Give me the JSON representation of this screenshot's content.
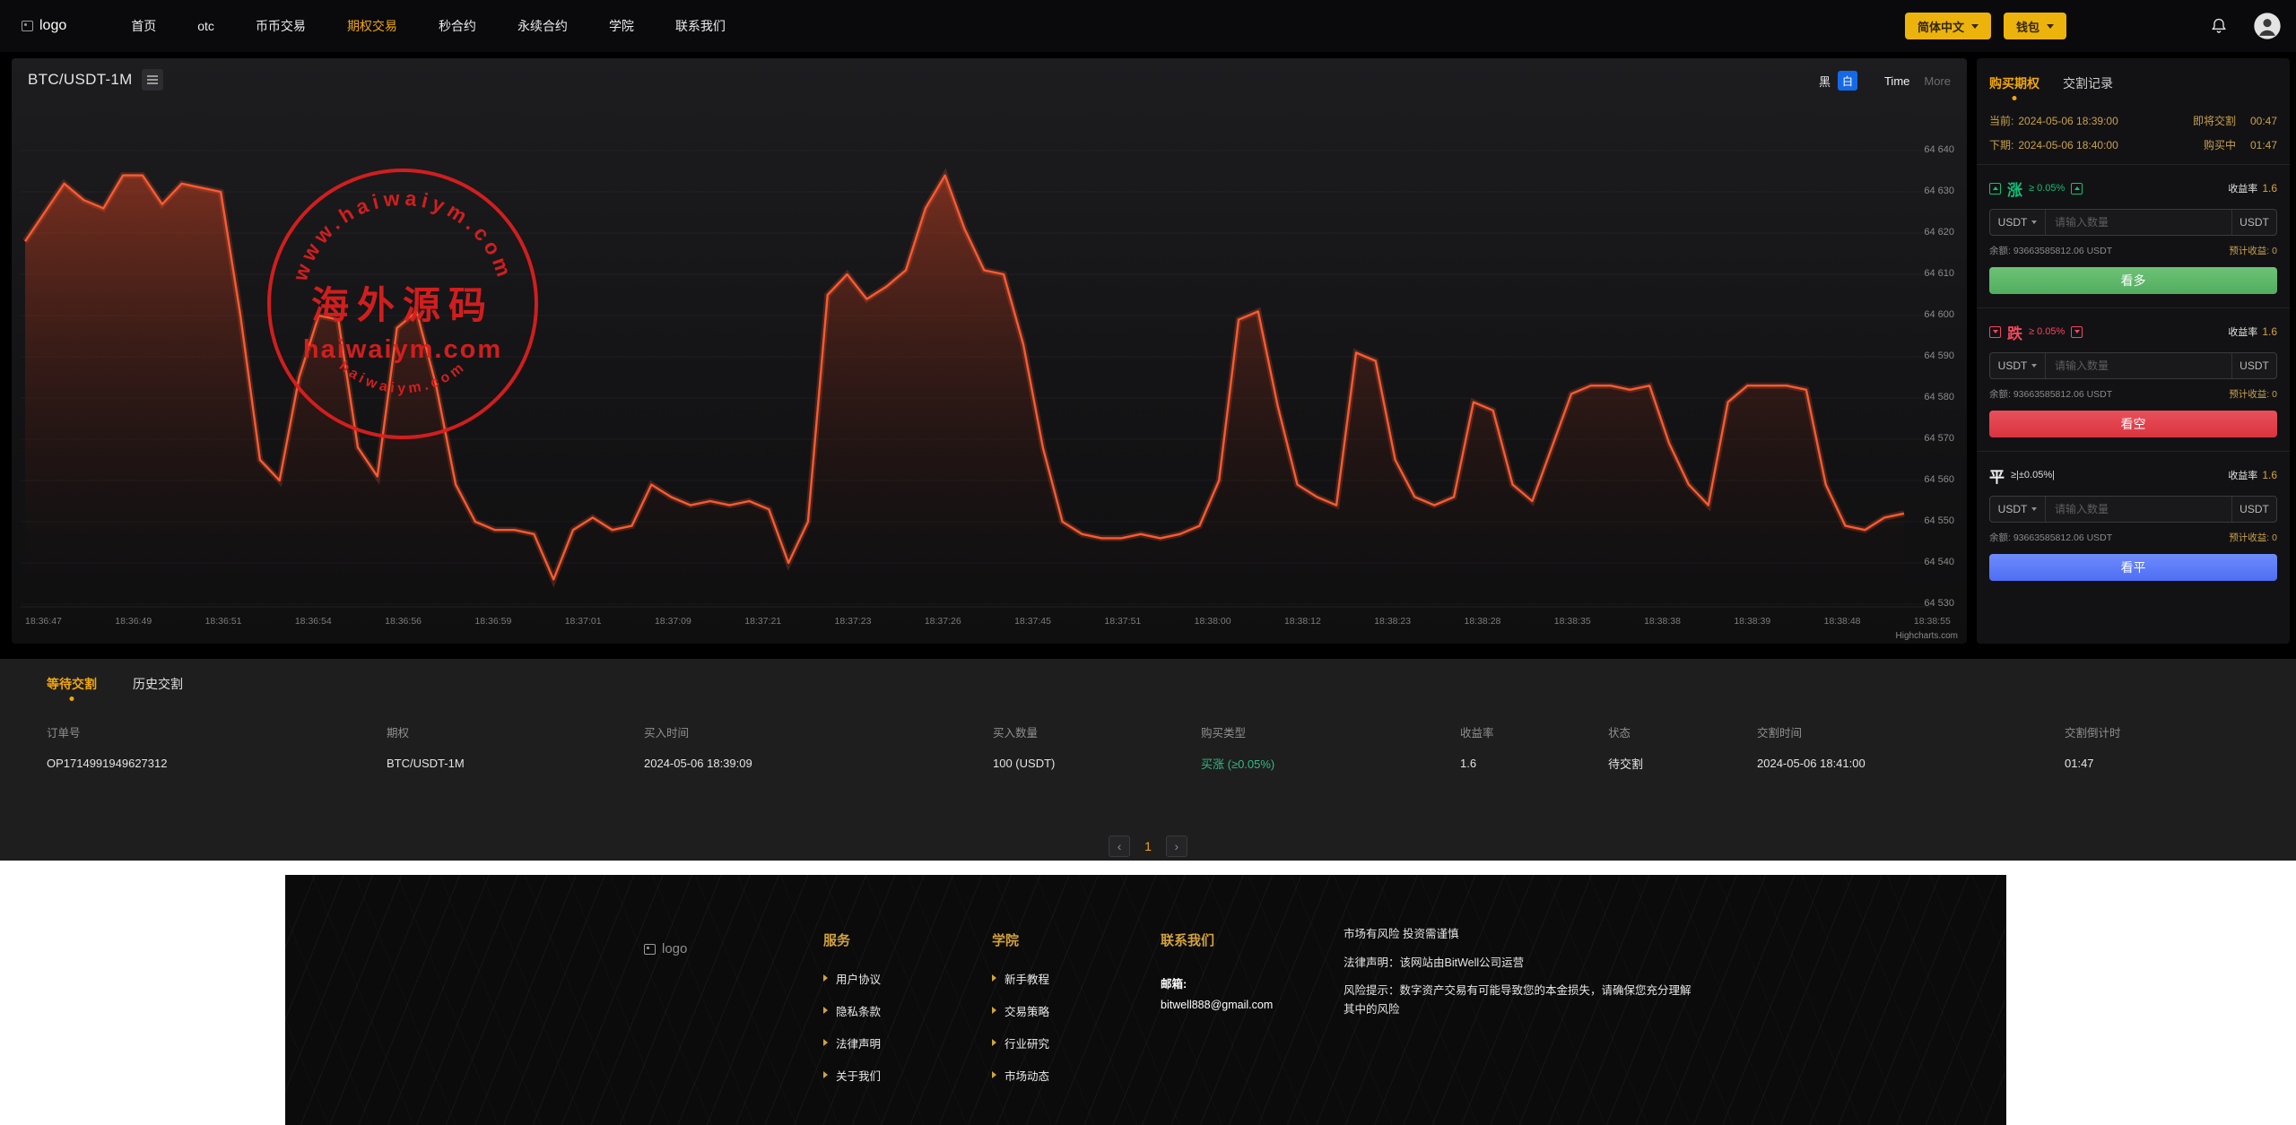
{
  "colors": {
    "accent_gold": "#f0a60e",
    "green": "#0fbf77",
    "red": "#f4465d",
    "blue": "#5b7bf7",
    "chart_line": "#fa5a30"
  },
  "nav": {
    "logo_text": "logo",
    "items": [
      {
        "label": "首页",
        "active": false
      },
      {
        "label": "otc",
        "active": false
      },
      {
        "label": "币币交易",
        "active": false
      },
      {
        "label": "期权交易",
        "active": true
      },
      {
        "label": "秒合约",
        "active": false
      },
      {
        "label": "永续合约",
        "active": false
      },
      {
        "label": "学院",
        "active": false
      },
      {
        "label": "联系我们",
        "active": false
      }
    ],
    "lang_button": "简体中文",
    "wallet_button": "钱包"
  },
  "chart": {
    "symbol": "BTC/USDT-1M",
    "theme_dark_label": "黑",
    "theme_light_label": "白",
    "interval_label": "Time",
    "more_label": "More",
    "credit": "Highcharts.com",
    "watermark": {
      "arc_top": "www.haiwaiym.com",
      "center": "海外源码",
      "line": "haiwaiym.com",
      "arc_bottom": "haiwaiym.com"
    },
    "chart_data": {
      "type": "line",
      "title": "",
      "xlabel": "",
      "ylabel": "",
      "ylim": [
        64530,
        64645
      ],
      "grid": true,
      "legend": false,
      "line_color": "#fa5a30",
      "area_color": "rgba(214,68,34,0.45)",
      "y_ticks": [
        "64 640",
        "64 630",
        "64 620",
        "64 610",
        "64 600",
        "64 590",
        "64 580",
        "64 570",
        "64 560",
        "64 550",
        "64 540",
        "64 530"
      ],
      "x_ticks": [
        "18:36:47",
        "18:36:49",
        "18:36:51",
        "18:36:54",
        "18:36:56",
        "18:36:59",
        "18:37:01",
        "18:37:09",
        "18:37:21",
        "18:37:23",
        "18:37:26",
        "18:37:45",
        "18:37:51",
        "18:38:00",
        "18:38:12",
        "18:38:23",
        "18:38:28",
        "18:38:35",
        "18:38:38",
        "18:38:39",
        "18:38:48",
        "18:38:55"
      ],
      "values": [
        64618,
        64625,
        64632,
        64628,
        64626,
        64634,
        64634,
        64627,
        64632,
        64631,
        64630,
        64600,
        64565,
        64560,
        64585,
        64600,
        64599,
        64568,
        64561,
        64597,
        64601,
        64583,
        64559,
        64550,
        64548,
        64548,
        64547,
        64536,
        64548,
        64551,
        64548,
        64549,
        64559,
        64556,
        64554,
        64555,
        64554,
        64555,
        64553,
        64540,
        64550,
        64605,
        64610,
        64604,
        64607,
        64611,
        64626,
        64634,
        64621,
        64611,
        64610,
        64593,
        64568,
        64550,
        64547,
        64546,
        64546,
        64547,
        64546,
        64547,
        64549,
        64560,
        64599,
        64601,
        64578,
        64559,
        64556,
        64554,
        64591,
        64589,
        64565,
        64556,
        64554,
        64556,
        64579,
        64577,
        64559,
        64555,
        64568,
        64581,
        64583,
        64583,
        64582,
        64583,
        64569,
        64559,
        64554,
        64579,
        64583,
        64583,
        64583,
        64582,
        64559,
        64549,
        64548,
        64551,
        64552
      ]
    }
  },
  "trade_panel": {
    "tabs": [
      {
        "label": "购买期权",
        "active": true
      },
      {
        "label": "交割记录",
        "active": false
      }
    ],
    "current": {
      "label": "当前:",
      "time": "2024-05-06 18:39:00",
      "status": "即将交割",
      "countdown": "00:47"
    },
    "next": {
      "label": "下期:",
      "time": "2024-05-06 18:40:00",
      "status": "购买中",
      "countdown": "01:47"
    },
    "sections": [
      {
        "direction": "涨",
        "condition": "≥ 0.05%",
        "rate_label": "收益率",
        "rate": "1.6",
        "currency": "USDT",
        "input_placeholder": "请输入数量",
        "unit": "USDT",
        "balance_label": "余额:",
        "balance": "93663585812.06 USDT",
        "profit_label": "预计收益:",
        "profit": "0",
        "button": "看多"
      },
      {
        "direction": "跌",
        "condition": "≥ 0.05%",
        "rate_label": "收益率",
        "rate": "1.6",
        "currency": "USDT",
        "input_placeholder": "请输入数量",
        "unit": "USDT",
        "balance_label": "余额:",
        "balance": "93663585812.06 USDT",
        "profit_label": "预计收益:",
        "profit": "0",
        "button": "看空"
      },
      {
        "direction": "平",
        "condition": "≥|±0.05%|",
        "rate_label": "收益率",
        "rate": "1.6",
        "currency": "USDT",
        "input_placeholder": "请输入数量",
        "unit": "USDT",
        "balance_label": "余额:",
        "balance": "93663585812.06 USDT",
        "profit_label": "预计收益:",
        "profit": "0",
        "button": "看平"
      }
    ]
  },
  "orders": {
    "tabs": [
      {
        "label": "等待交割",
        "active": true
      },
      {
        "label": "历史交割",
        "active": false
      }
    ],
    "columns": [
      "订单号",
      "期权",
      "买入时间",
      "买入数量",
      "购买类型",
      "收益率",
      "状态",
      "交割时间",
      "交割倒计时"
    ],
    "rows": [
      {
        "order_id": "OP1714991949627312",
        "option": "BTC/USDT-1M",
        "buy_time": "2024-05-06 18:39:09",
        "amount": "100 (USDT)",
        "buy_type": "买涨 (≥0.05%)",
        "rate": "1.6",
        "status": "待交割",
        "settle_time": "2024-05-06 18:41:00",
        "countdown": "01:47"
      }
    ],
    "pagination": {
      "prev": "‹",
      "page": "1",
      "next": "›"
    }
  },
  "footer": {
    "logo_text": "logo",
    "columns": [
      {
        "title": "服务",
        "links": [
          "用户协议",
          "隐私条款",
          "法律声明",
          "关于我们"
        ]
      },
      {
        "title": "学院",
        "links": [
          "新手教程",
          "交易策略",
          "行业研究",
          "市场动态"
        ]
      }
    ],
    "contact": {
      "title": "联系我们",
      "email_label": "邮箱:",
      "email": "bitwell888@gmail.com"
    },
    "disclaimer": [
      "市场有风险 投资需谨慎",
      "法律声明：该网站由BitWell公司运营",
      "风险提示：数字资产交易有可能导致您的本金损失，请确保您充分理解其中的风险"
    ]
  }
}
